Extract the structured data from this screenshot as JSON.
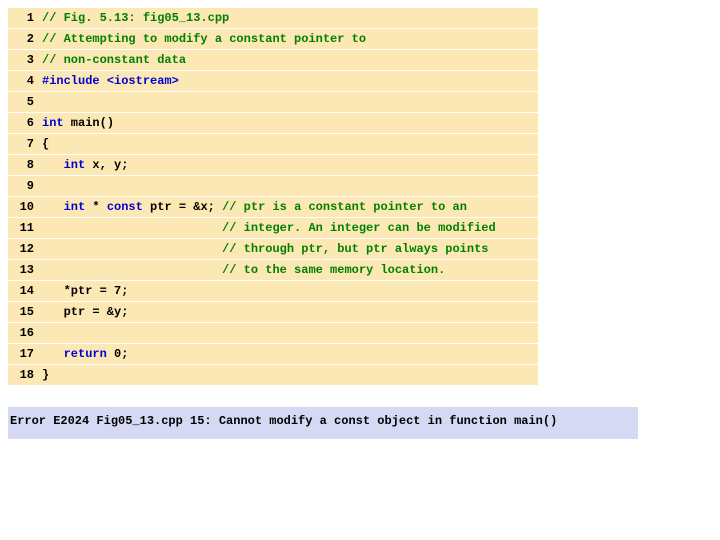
{
  "code": {
    "lines": [
      {
        "n": "1",
        "segments": [
          {
            "c": "cm",
            "t": "// Fig. 5.13: fig05_13.cpp"
          }
        ]
      },
      {
        "n": "2",
        "segments": [
          {
            "c": "cm",
            "t": "// Attempting to modify a constant pointer to"
          }
        ]
      },
      {
        "n": "3",
        "segments": [
          {
            "c": "cm",
            "t": "// non-constant data"
          }
        ]
      },
      {
        "n": "4",
        "segments": [
          {
            "c": "pp",
            "t": "#include"
          },
          {
            "c": "",
            "t": " "
          },
          {
            "c": "kw",
            "t": "<iostream>"
          }
        ]
      },
      {
        "n": "5",
        "segments": [
          {
            "c": "",
            "t": " "
          }
        ]
      },
      {
        "n": "6",
        "segments": [
          {
            "c": "kw",
            "t": "int"
          },
          {
            "c": "",
            "t": " main()"
          }
        ]
      },
      {
        "n": "7",
        "segments": [
          {
            "c": "",
            "t": "{"
          }
        ]
      },
      {
        "n": "8",
        "segments": [
          {
            "c": "",
            "t": "   "
          },
          {
            "c": "kw",
            "t": "int"
          },
          {
            "c": "",
            "t": " x, y;"
          }
        ]
      },
      {
        "n": "9",
        "segments": [
          {
            "c": "",
            "t": " "
          }
        ]
      },
      {
        "n": "10",
        "segments": [
          {
            "c": "",
            "t": "   "
          },
          {
            "c": "kw",
            "t": "int"
          },
          {
            "c": "",
            "t": " * "
          },
          {
            "c": "kw",
            "t": "const"
          },
          {
            "c": "",
            "t": " ptr = &x; "
          },
          {
            "c": "cm",
            "t": "// ptr is a constant pointer to an"
          }
        ]
      },
      {
        "n": "11",
        "segments": [
          {
            "c": "",
            "t": "                         "
          },
          {
            "c": "cm",
            "t": "// integer. An integer can be modified"
          }
        ]
      },
      {
        "n": "12",
        "segments": [
          {
            "c": "",
            "t": "                         "
          },
          {
            "c": "cm",
            "t": "// through ptr, but ptr always points"
          }
        ]
      },
      {
        "n": "13",
        "segments": [
          {
            "c": "",
            "t": "                         "
          },
          {
            "c": "cm",
            "t": "// to the same memory location."
          }
        ]
      },
      {
        "n": "14",
        "segments": [
          {
            "c": "",
            "t": "   *ptr = 7;"
          }
        ]
      },
      {
        "n": "15",
        "segments": [
          {
            "c": "",
            "t": "   ptr = &y;"
          }
        ]
      },
      {
        "n": "16",
        "segments": [
          {
            "c": "",
            "t": " "
          }
        ]
      },
      {
        "n": "17",
        "segments": [
          {
            "c": "",
            "t": "   "
          },
          {
            "c": "kw",
            "t": "return"
          },
          {
            "c": "",
            "t": " 0;"
          }
        ]
      },
      {
        "n": "18",
        "segments": [
          {
            "c": "",
            "t": "}"
          }
        ]
      }
    ]
  },
  "error": {
    "text": "Error E2024 Fig05_13.cpp 15: Cannot modify a const object in function main()"
  }
}
